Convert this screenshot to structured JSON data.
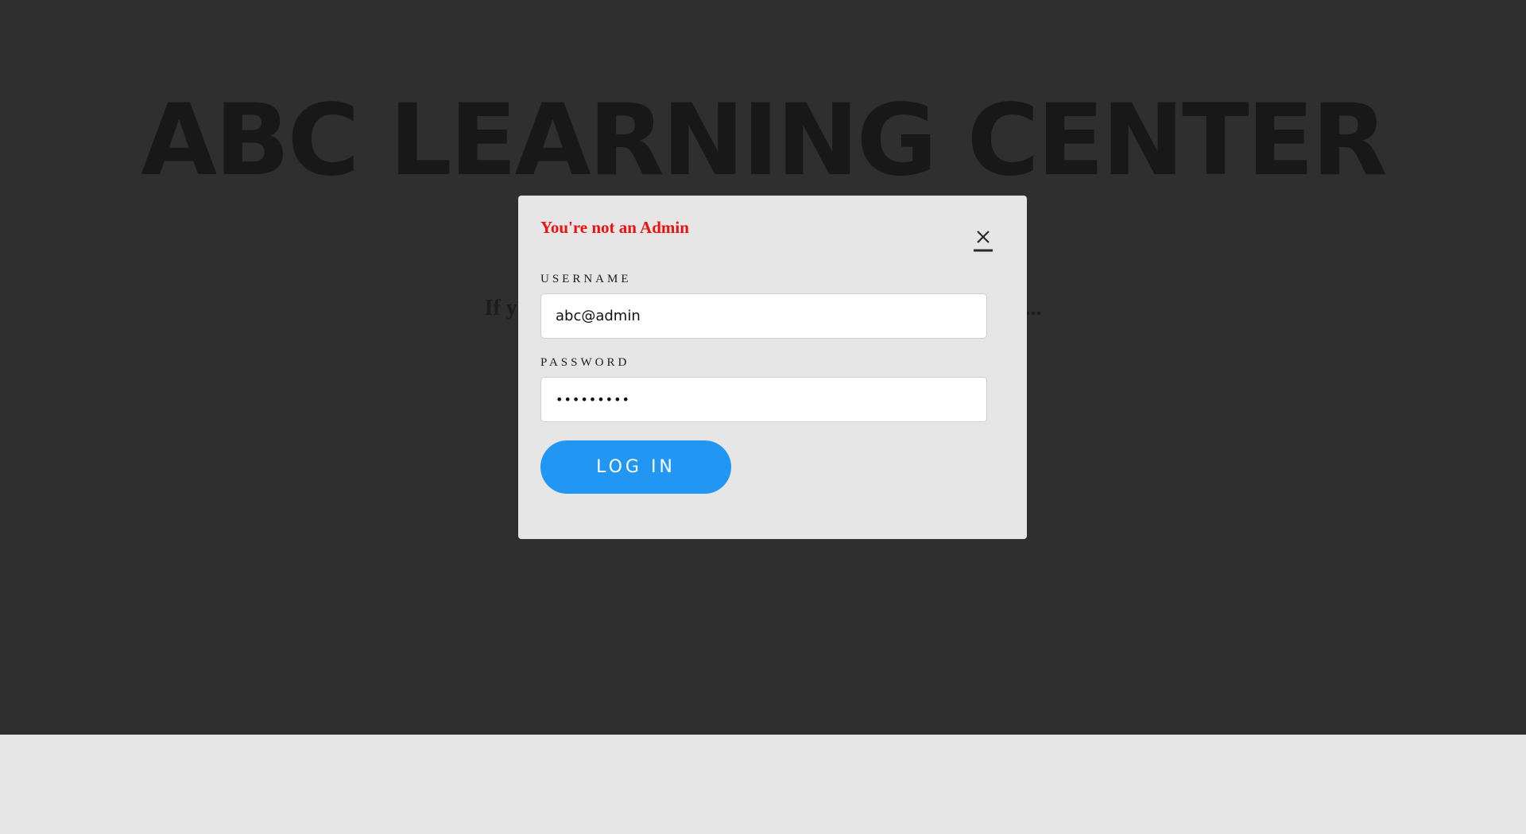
{
  "hero": {
    "title": "ABC LEARNING CENTER",
    "subtitle": "If you are an admin, please login to continue. Else, please..."
  },
  "modal": {
    "error_message": "You're not an Admin",
    "close_icon": "close-icon",
    "username": {
      "label": "USERNAME",
      "value": "abc@admin"
    },
    "password": {
      "label": "PASSWORD",
      "value": "•••••••••"
    },
    "login_label": "LOG IN"
  },
  "colors": {
    "backdrop": "#2f2f2f",
    "error": "#ee1111",
    "button": "#2196f3",
    "modal": "#e6e6e6"
  }
}
